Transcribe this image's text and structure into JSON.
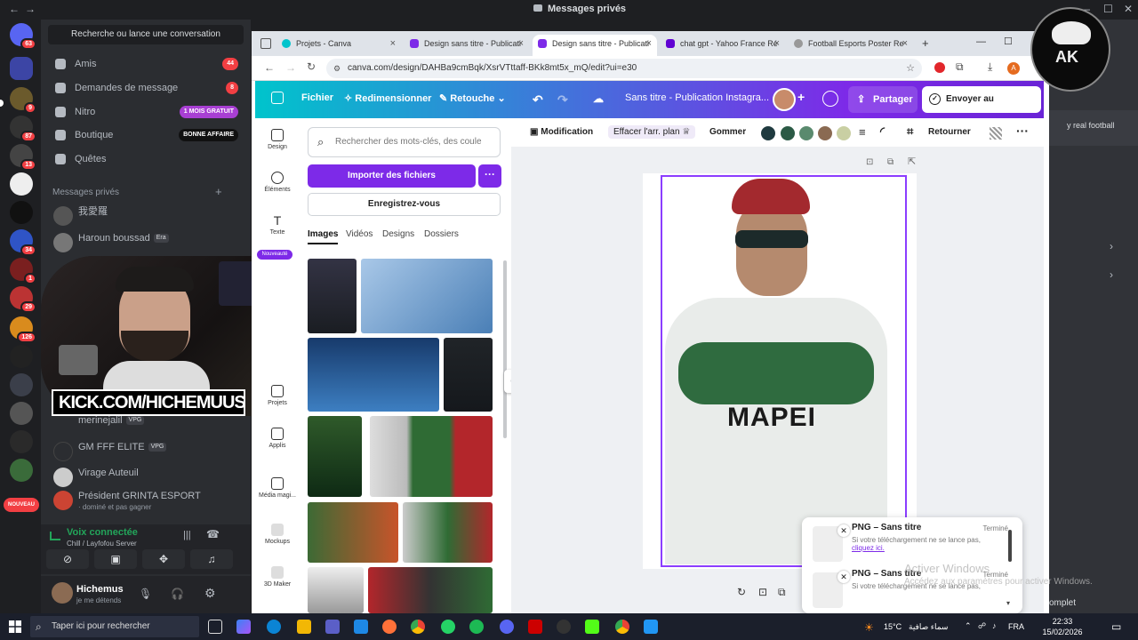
{
  "discord": {
    "window_title": "Messages privés",
    "search_placeholder": "Recherche ou lance une conversation",
    "nav": [
      {
        "label": "Amis",
        "badge": "44"
      },
      {
        "label": "Demandes de message",
        "badge": "8"
      },
      {
        "label": "Nitro",
        "pill": "1 MOIS GRATUIT"
      },
      {
        "label": "Boutique",
        "pill": "BONNE AFFAIRE"
      },
      {
        "label": "Quêtes"
      }
    ],
    "dm_header": "Messages privés",
    "dms": [
      {
        "name": "我愛羅",
        "sub": ""
      },
      {
        "name": "Haroun boussad",
        "tag": "Era",
        "sub": ""
      },
      {
        "name": "merinejalil",
        "tag": "VPG",
        "sub": ""
      },
      {
        "name": "GM FFF ELITE",
        "tag": "VPG",
        "sub": ""
      },
      {
        "name": "Virage Auteuil",
        "sub": ""
      },
      {
        "name": "Président GRINTA ESPORT",
        "sub": "· dominé et pas gagner"
      }
    ],
    "server_badges": [
      "63",
      "9",
      "87",
      "13",
      "34",
      "1",
      "29",
      "126"
    ],
    "new_label": "NOUVEAU",
    "voice": {
      "status": "Voix connectée",
      "channel": "Chill / Layfofou Server"
    },
    "user": {
      "name": "Hichemus",
      "status": "je me détends"
    },
    "right_snippet": "y real football"
  },
  "overlay": {
    "kick": "KICK.COM/HICHEMUUS"
  },
  "chrome": {
    "tabs": [
      {
        "label": "Projets - Canva"
      },
      {
        "label": "Design sans titre - Publicati"
      },
      {
        "label": "Design sans titre - Publicati"
      },
      {
        "label": "chat gpt - Yahoo France Ré"
      },
      {
        "label": "Football Esports Poster Re"
      }
    ],
    "url": "canva.com/design/DAHBa9cmBqk/XsrVTttaff-BKk8mt5x_mQ/edit?ui=e30"
  },
  "canva": {
    "menu_file": "Fichier",
    "menu_resize": "Redimensionner",
    "menu_retouch": "Retouche",
    "doc_title": "Sans titre - Publication Instagra...",
    "share": "Partager",
    "send_teacher": "Envoyer au professeur",
    "rail": [
      "Design",
      "Éléments",
      "Texte",
      "Nouveauté",
      "Projets",
      "Applis",
      "Média magi...",
      "Mockups",
      "3D Maker"
    ],
    "side": {
      "search_placeholder": "Rechercher des mots-clés, des coule",
      "import": "Importer des fichiers",
      "save": "Enregistrez-vous",
      "tabs": [
        "Images",
        "Vidéos",
        "Designs",
        "Dossiers"
      ]
    },
    "toolbar": {
      "edit": "Modification",
      "bg_remove": "Effacer l'arr. plan",
      "erase": "Gommer",
      "flip": "Retourner",
      "colors": [
        "#1f3a3f",
        "#2b5a45",
        "#5a8a6e",
        "#8a6a52",
        "#c9cfa3"
      ]
    },
    "jersey_text": "MAPEI"
  },
  "downloads": [
    {
      "title": "PNG – Sans titre",
      "state": "Terminé",
      "msg": "Si votre téléchargement ne se lance pas,",
      "link": "cliquez ici."
    },
    {
      "title": "PNG – Sans titre",
      "state": "Terminé",
      "msg": "Si votre téléchargement ne se lance pas,"
    }
  ],
  "windows": {
    "activate_title": "Activer Windows",
    "activate_sub": "Accédez aux paramètres pour activer Windows.",
    "search": "Taper ici pour rechercher",
    "temp": "15°C",
    "weather": "سماء صافية",
    "lang": "FRA",
    "time": "22:33",
    "date": "15/02/2026",
    "complete": "omplet"
  }
}
